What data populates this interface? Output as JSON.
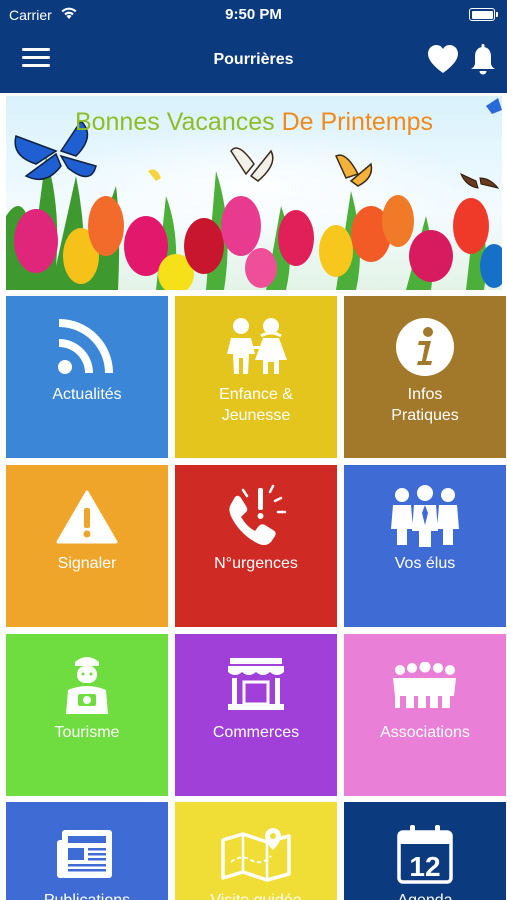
{
  "status_bar": {
    "carrier": "Carrier",
    "time": "9:50 PM"
  },
  "header": {
    "title": "Pourrières",
    "menu_icon": "hamburger-menu-icon",
    "favorite_icon": "heart-icon",
    "notification_icon": "bell-icon"
  },
  "banner": {
    "text_part1": "Bonnes Vacances",
    "text_part2": "De Printemps"
  },
  "tiles": [
    {
      "label": "Actualités",
      "color": "#3b86d6",
      "icon": "rss-icon"
    },
    {
      "label": "Enfance &\nJeunesse",
      "color": "#e3c51e",
      "icon": "children-icon"
    },
    {
      "label": "Infos\nPratiques",
      "color": "#a2792a",
      "icon": "info-icon"
    },
    {
      "label": "Signaler",
      "color": "#eea52a",
      "icon": "warning-icon"
    },
    {
      "label": "N°urgences",
      "color": "#cf2a23",
      "icon": "emergency-phone-icon"
    },
    {
      "label": "Vos élus",
      "color": "#3f6bd4",
      "icon": "elected-officials-icon"
    },
    {
      "label": "Tourisme",
      "color": "#6fdd3f",
      "icon": "tourist-icon"
    },
    {
      "label": "Commerces",
      "color": "#a040d8",
      "icon": "shop-icon"
    },
    {
      "label": "Associations",
      "color": "#ea7fd8",
      "icon": "people-group-icon"
    },
    {
      "label": "Publications",
      "color": "#3f6bd4",
      "icon": "newspaper-icon"
    },
    {
      "label": "Visite guidée",
      "color": "#f0dd35",
      "icon": "map-icon"
    },
    {
      "label": "Agenda",
      "color": "#0c3a7e",
      "icon": "calendar-icon",
      "day": "12"
    }
  ]
}
